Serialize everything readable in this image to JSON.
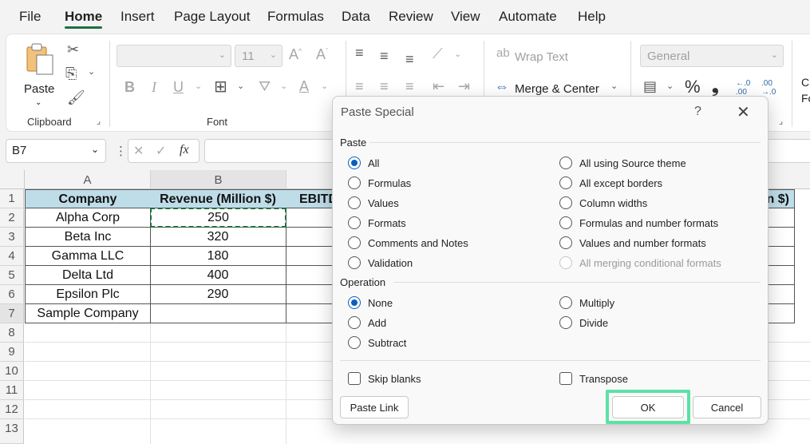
{
  "menu": {
    "tabs": [
      "File",
      "Home",
      "Insert",
      "Page Layout",
      "Formulas",
      "Data",
      "Review",
      "View",
      "Automate",
      "Help"
    ],
    "active": "Home"
  },
  "ribbon": {
    "clipboard": {
      "paste_label": "Paste",
      "group_label": "Clipboard"
    },
    "font": {
      "font_name": "",
      "font_size": "11",
      "group_label": "Font"
    },
    "alignment": {
      "wrap_text": "Wrap Text",
      "merge_center": "Merge & Center"
    },
    "number": {
      "format": "General",
      "percent": "%",
      "comma": "❟",
      "inc_decimal": "←.0 .00",
      "dec_decimal": ".00 →.0"
    },
    "cut_off_label": "C\nFo"
  },
  "formula_bar": {
    "name_box": "B7",
    "fx": "fx",
    "value": ""
  },
  "sheet": {
    "columns": [
      "A",
      "B"
    ],
    "rows": [
      "1",
      "2",
      "3",
      "4",
      "5",
      "6",
      "7",
      "8",
      "9",
      "10",
      "11",
      "12",
      "13"
    ],
    "header_row": {
      "company": "Company",
      "revenue": "Revenue (Million $)",
      "ebitda_partial": "EBITD",
      "right_partial": "n $)"
    },
    "data": [
      {
        "company": "Alpha Corp",
        "revenue": "250"
      },
      {
        "company": "Beta Inc",
        "revenue": "320"
      },
      {
        "company": "Gamma LLC",
        "revenue": "180"
      },
      {
        "company": "Delta Ltd",
        "revenue": "400"
      },
      {
        "company": "Epsilon Plc",
        "revenue": "290"
      },
      {
        "company": "Sample Company",
        "revenue": ""
      }
    ],
    "header_color": "#bfdde9",
    "copy_marquee_color": "#1e6e42"
  },
  "dialog": {
    "title": "Paste Special",
    "help": "?",
    "close": "✕",
    "paste_section": "Paste",
    "paste_options_left": [
      "All",
      "Formulas",
      "Values",
      "Formats",
      "Comments and Notes",
      "Validation"
    ],
    "paste_options_right": [
      "All using Source theme",
      "All except borders",
      "Column widths",
      "Formulas and number formats",
      "Values and number formats",
      "All merging conditional formats"
    ],
    "paste_selected": "All",
    "operation_section": "Operation",
    "operation_left": [
      "None",
      "Add",
      "Subtract"
    ],
    "operation_right": [
      "Multiply",
      "Divide"
    ],
    "operation_selected": "None",
    "skip_blanks": "Skip blanks",
    "transpose": "Transpose",
    "paste_link": "Paste Link",
    "ok": "OK",
    "cancel": "Cancel",
    "highlight_color": "#5de1a6"
  }
}
